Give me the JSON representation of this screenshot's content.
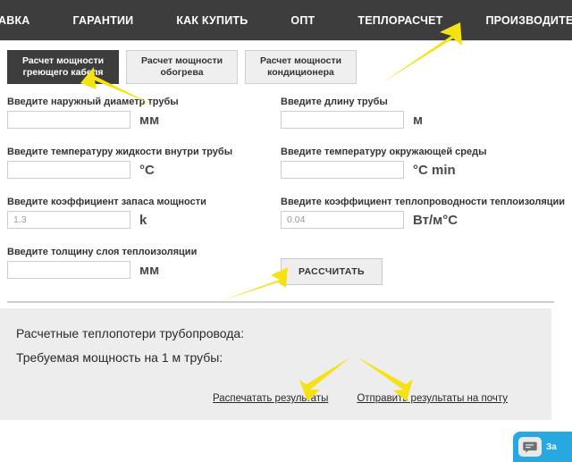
{
  "nav": {
    "items": [
      {
        "label": "АВКА"
      },
      {
        "label": "ГАРАНТИИ"
      },
      {
        "label": "КАК КУПИТЬ"
      },
      {
        "label": "ОПТ"
      },
      {
        "label": "ТЕПЛОРАСЧЕТ"
      },
      {
        "label": "ПРОИЗВОДИТЕЛИ"
      }
    ]
  },
  "tabs": [
    {
      "label": "Расчет мощности греющего кабеля",
      "active": true
    },
    {
      "label": "Расчет мощности обогрева",
      "active": false
    },
    {
      "label": "Расчет мощности кондиционера",
      "active": false
    }
  ],
  "form": {
    "fields": [
      {
        "label": "Введите наружный диаметр трубы",
        "value": "",
        "placeholder": "",
        "unit": "мм"
      },
      {
        "label": "Введите длину трубы",
        "value": "",
        "placeholder": "",
        "unit": "м"
      },
      {
        "label": "Введите температуру жидкости внутри трубы",
        "value": "",
        "placeholder": "",
        "unit": "°C"
      },
      {
        "label": "Введите температуру окружающей среды",
        "value": "",
        "placeholder": "",
        "unit": "°C min"
      },
      {
        "label": "Введите коэффициент запаса мощности",
        "value": "",
        "placeholder": "1.3",
        "unit": "k"
      },
      {
        "label": "Введите коэффициент теплопроводности теплоизоляции",
        "value": "",
        "placeholder": "0.04",
        "unit": "Вт/м°С"
      },
      {
        "label": "Введите толщину слоя теплоизоляции",
        "value": "",
        "placeholder": "",
        "unit": "мм"
      }
    ],
    "calculate_label": "РАССЧИТАТЬ"
  },
  "results": {
    "heat_loss_label": "Расчетные теплопотери трубопровода:",
    "power_per_meter_label": "Требуемая мощность на 1 м трубы:",
    "print_link": "Распечатать результаты",
    "email_link": "Отправить результаты на почту"
  },
  "chat_widget": {
    "label": "За",
    "icon": "chat-bubble-icon",
    "color": "#28a8e0"
  },
  "colors": {
    "nav_background": "#3d3d3d",
    "active_tab": "#3d3d3d",
    "panel_background": "#ededed",
    "annotation_arrow": "#f5e214"
  }
}
